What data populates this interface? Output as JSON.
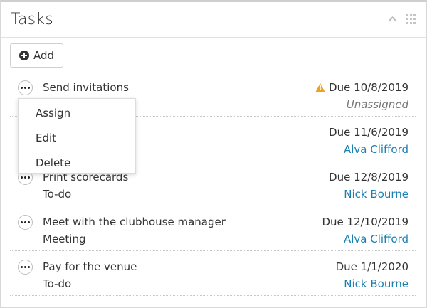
{
  "panel": {
    "title": "Tasks",
    "icons": [
      "chevron-up-icon",
      "grid-icon"
    ]
  },
  "toolbar": {
    "add_label": "Add"
  },
  "context_menu": {
    "items": [
      "Assign",
      "Edit",
      "Delete"
    ]
  },
  "tasks": [
    {
      "title": "Send invitations",
      "type": "",
      "due": "Due 10/8/2019",
      "assignee": "Unassigned",
      "warning": true,
      "unassigned": true
    },
    {
      "title": "",
      "type": "",
      "due": "Due 11/6/2019",
      "assignee": "Alva Clifford",
      "warning": false,
      "unassigned": false
    },
    {
      "title": "Print scorecards",
      "type": "To-do",
      "due": "Due 12/8/2019",
      "assignee": "Nick Bourne",
      "warning": false,
      "unassigned": false
    },
    {
      "title": "Meet with the clubhouse manager",
      "type": "Meeting",
      "due": "Due 12/10/2019",
      "assignee": "Alva Clifford",
      "warning": false,
      "unassigned": false
    },
    {
      "title": "Pay for the venue",
      "type": "To-do",
      "due": "Due 1/1/2020",
      "assignee": "Nick Bourne",
      "warning": false,
      "unassigned": false
    }
  ],
  "colors": {
    "link": "#1a7fb0",
    "warning": "#f0a020",
    "border": "#d8d8d8"
  }
}
